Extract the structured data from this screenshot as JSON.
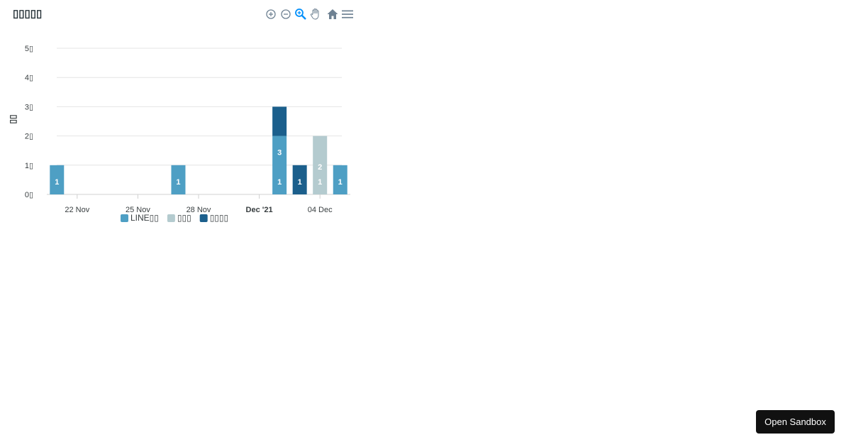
{
  "toolbar": {
    "icons": [
      "zoom-in-icon",
      "zoom-out-icon",
      "selection-zoom-icon",
      "pan-icon",
      "reset-home-icon",
      "menu-icon"
    ],
    "active_color": "#008ffb",
    "icon_color": "#6e8192"
  },
  "chart_data": {
    "type": "bar",
    "stacked": true,
    "title": "▯▯▯▯▯",
    "xlabel": "",
    "ylabel": "▯▯",
    "x": [
      "2021-11-21",
      "2021-11-27",
      "2021-12-02",
      "2021-12-03",
      "2021-12-04",
      "2021-12-05"
    ],
    "x_ticks": [
      {
        "date": "2021-11-22",
        "label": "22 Nov",
        "bold": false
      },
      {
        "date": "2021-11-25",
        "label": "25 Nov",
        "bold": false
      },
      {
        "date": "2021-11-28",
        "label": "28 Nov",
        "bold": false
      },
      {
        "date": "2021-12-01",
        "label": "Dec '21",
        "bold": true
      },
      {
        "date": "2021-12-04",
        "label": "04 Dec",
        "bold": false
      }
    ],
    "x_range": [
      "2021-11-20.5",
      "2021-12-05.5"
    ],
    "ylim": [
      0,
      5
    ],
    "y_ticks": [
      {
        "value": 0,
        "label": "0▯"
      },
      {
        "value": 1,
        "label": "1▯"
      },
      {
        "value": 2,
        "label": "2▯"
      },
      {
        "value": 3,
        "label": "3▯"
      },
      {
        "value": 4,
        "label": "4▯"
      },
      {
        "value": 5,
        "label": "5▯"
      }
    ],
    "grid": true,
    "legend_position": "bottom",
    "series": [
      {
        "name": "LINE▯▯",
        "color": "#4e9fc4",
        "values": [
          1,
          1,
          2,
          0,
          0,
          1
        ]
      },
      {
        "name": "▯▯▯",
        "color": "#b4cbcf",
        "values": [
          0,
          0,
          0,
          0,
          2,
          0
        ]
      },
      {
        "name": "▯▯▯▯",
        "color": "#1b5f8c",
        "values": [
          0,
          0,
          1,
          1,
          0,
          0
        ]
      }
    ],
    "data_labels": [
      {
        "date": "2021-11-21",
        "value": 1,
        "text": "1"
      },
      {
        "date": "2021-11-27",
        "value": 1,
        "text": "1"
      },
      {
        "date": "2021-12-02",
        "value": 1,
        "text": "1"
      },
      {
        "date": "2021-12-02",
        "value": 2,
        "text": "3"
      },
      {
        "date": "2021-12-03",
        "value": 1,
        "text": "1"
      },
      {
        "date": "2021-12-04",
        "value": 1,
        "text": "1"
      },
      {
        "date": "2021-12-04",
        "value": 1.5,
        "text": "2"
      },
      {
        "date": "2021-12-05",
        "value": 1,
        "text": "1"
      }
    ]
  },
  "sandbox_button": {
    "label": "Open Sandbox"
  }
}
